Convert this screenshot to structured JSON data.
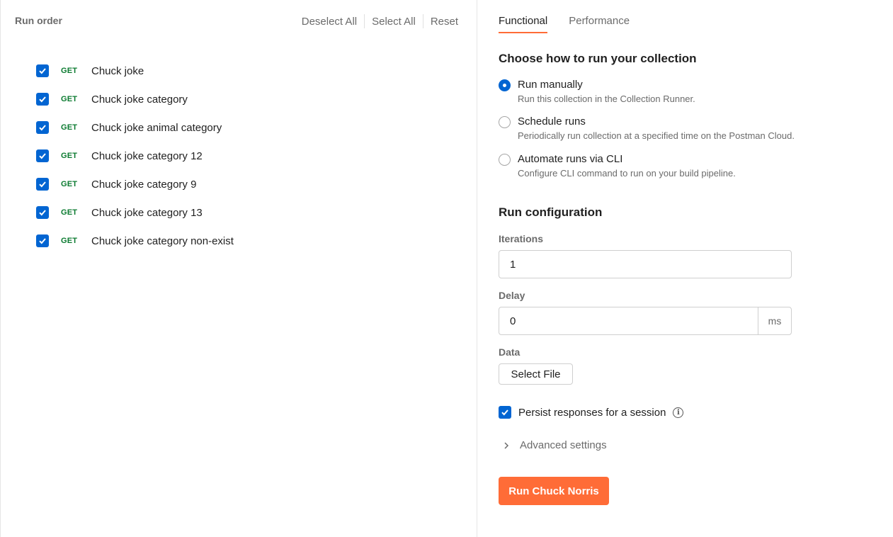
{
  "left": {
    "title": "Run order",
    "toolbar": {
      "deselect_all": "Deselect All",
      "select_all": "Select All",
      "reset": "Reset"
    },
    "requests": [
      {
        "method": "GET",
        "name": "Chuck joke",
        "checked": true
      },
      {
        "method": "GET",
        "name": "Chuck joke category",
        "checked": true
      },
      {
        "method": "GET",
        "name": "Chuck joke animal category",
        "checked": true
      },
      {
        "method": "GET",
        "name": "Chuck joke category 12",
        "checked": true
      },
      {
        "method": "GET",
        "name": "Chuck joke category 9",
        "checked": true
      },
      {
        "method": "GET",
        "name": "Chuck joke category 13",
        "checked": true
      },
      {
        "method": "GET",
        "name": "Chuck joke category non-exist",
        "checked": true
      }
    ]
  },
  "right": {
    "tabs": [
      {
        "label": "Functional",
        "active": true
      },
      {
        "label": "Performance",
        "active": false
      }
    ],
    "run_heading": "Choose how to run your collection",
    "run_options": [
      {
        "label": "Run manually",
        "desc": "Run this collection in the Collection Runner.",
        "selected": true
      },
      {
        "label": "Schedule runs",
        "desc": "Periodically run collection at a specified time on the Postman Cloud.",
        "selected": false
      },
      {
        "label": "Automate runs via CLI",
        "desc": "Configure CLI command to run on your build pipeline.",
        "selected": false
      }
    ],
    "config_heading": "Run configuration",
    "iterations": {
      "label": "Iterations",
      "value": "1"
    },
    "delay": {
      "label": "Delay",
      "value": "0",
      "unit": "ms"
    },
    "data": {
      "label": "Data",
      "button": "Select File"
    },
    "persist": {
      "label": "Persist responses for a session",
      "checked": true
    },
    "advanced": {
      "label": "Advanced settings"
    },
    "run_button": "Run Chuck Norris"
  },
  "colors": {
    "accent": "#ff6c37",
    "checkbox": "#0265d2",
    "method_get": "#0a7a2f"
  }
}
